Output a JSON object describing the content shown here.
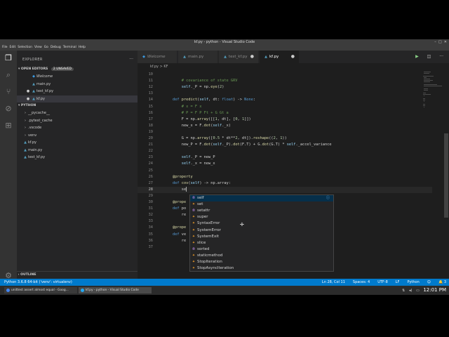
{
  "window": {
    "title": "kf.py - python - Visual Studio Code",
    "menu": [
      "File",
      "Edit",
      "Selection",
      "View",
      "Go",
      "Debug",
      "Terminal",
      "Help"
    ]
  },
  "activity_icons": [
    "files-icon",
    "search-icon",
    "source-control-icon",
    "debug-icon",
    "extensions-icon"
  ],
  "sidebar": {
    "title": "EXPLORER",
    "open_editors_label": "OPEN EDITORS",
    "unsaved_badge": "2 UNSAVED",
    "open_editors": [
      {
        "label": "Welcome",
        "icon": "vscode-icon",
        "dirty": false
      },
      {
        "label": "main.py",
        "icon": "python-icon",
        "dirty": false
      },
      {
        "label": "test_kf.py",
        "icon": "python-icon",
        "dirty": true
      },
      {
        "label": "kf.py",
        "icon": "python-icon",
        "dirty": true
      }
    ],
    "folder_label": "PYTHON",
    "folder_items": [
      {
        "label": "__pycache__",
        "type": "folder"
      },
      {
        "label": ".pytest_cache",
        "type": "folder"
      },
      {
        "label": ".vscode",
        "type": "folder"
      },
      {
        "label": "venv",
        "type": "folder"
      },
      {
        "label": "kf.py",
        "type": "file"
      },
      {
        "label": "main.py",
        "type": "file"
      },
      {
        "label": "test_kf.py",
        "type": "file"
      }
    ],
    "outline_label": "OUTLINE"
  },
  "tabs": [
    {
      "label": "Welcome",
      "active": false,
      "dirty": false
    },
    {
      "label": "main.py",
      "active": false,
      "dirty": false
    },
    {
      "label": "test_kf.py",
      "active": false,
      "dirty": true
    },
    {
      "label": "kf.py",
      "active": true,
      "dirty": true
    }
  ],
  "breadcrumb": "kf.py > KF",
  "code_lines": [
    {
      "n": "10",
      "text": ""
    },
    {
      "n": "11",
      "text": "        # covariance of state GRV"
    },
    {
      "n": "12",
      "text": "        self._P = np.eye(2)"
    },
    {
      "n": "13",
      "text": ""
    },
    {
      "n": "14",
      "text": "    def predict(self, dt: float) -> None:"
    },
    {
      "n": "15",
      "text": "        # x = F x"
    },
    {
      "n": "16",
      "text": "        # P = F P Ft + G Gt a"
    },
    {
      "n": "17",
      "text": "        F = np.array([[1, dt], [0, 1]])"
    },
    {
      "n": "18",
      "text": "        new_x = F.dot(self._x)"
    },
    {
      "n": "19",
      "text": ""
    },
    {
      "n": "20",
      "text": "        G = np.array([0.5 * dt**2, dt]).reshape((2, 1))"
    },
    {
      "n": "21",
      "text": "        new_P = F.dot(self._P).dot(F.T) + G.dot(G.T) * self._accel_variance"
    },
    {
      "n": "22",
      "text": ""
    },
    {
      "n": "23",
      "text": "        self._P = new_P"
    },
    {
      "n": "24",
      "text": "        self._x = new_x"
    },
    {
      "n": "25",
      "text": ""
    },
    {
      "n": "26",
      "text": "    @property"
    },
    {
      "n": "27",
      "text": "    def cov(self) -> np.array:"
    },
    {
      "n": "28",
      "text": "        se"
    },
    {
      "n": "29",
      "text": ""
    },
    {
      "n": "30",
      "text": "    @prope"
    },
    {
      "n": "31",
      "text": "    def po"
    },
    {
      "n": "32",
      "text": "        re"
    },
    {
      "n": "33",
      "text": ""
    },
    {
      "n": "34",
      "text": "    @prope"
    },
    {
      "n": "35",
      "text": "    def ve"
    },
    {
      "n": "36",
      "text": "        re"
    },
    {
      "n": "37",
      "text": ""
    }
  ],
  "suggestions": [
    {
      "label": "self",
      "kind": "keyword"
    },
    {
      "label": "set",
      "kind": "class"
    },
    {
      "label": "setattr",
      "kind": "keyword"
    },
    {
      "label": "super",
      "kind": "class"
    },
    {
      "label": "SyntaxError",
      "kind": "class"
    },
    {
      "label": "SystemError",
      "kind": "class"
    },
    {
      "label": "SystemExit",
      "kind": "class"
    },
    {
      "label": "slice",
      "kind": "class"
    },
    {
      "label": "sorted",
      "kind": "keyword"
    },
    {
      "label": "staticmethod",
      "kind": "class"
    },
    {
      "label": "StopIteration",
      "kind": "class"
    },
    {
      "label": "StopAsyncIteration",
      "kind": "class"
    }
  ],
  "status": {
    "left": "Python 3.6.8 64-bit ('venv': virtualenv)",
    "right": [
      "Ln 28, Col 11",
      "Spaces: 4",
      "UTF-8",
      "LF",
      "Python"
    ],
    "bell": "3"
  },
  "taskbar": {
    "apps": [
      "unittest assert almost equal - Goog...",
      "kf.py - python - Visual Studio Code"
    ],
    "clock": "12:01 PM"
  }
}
